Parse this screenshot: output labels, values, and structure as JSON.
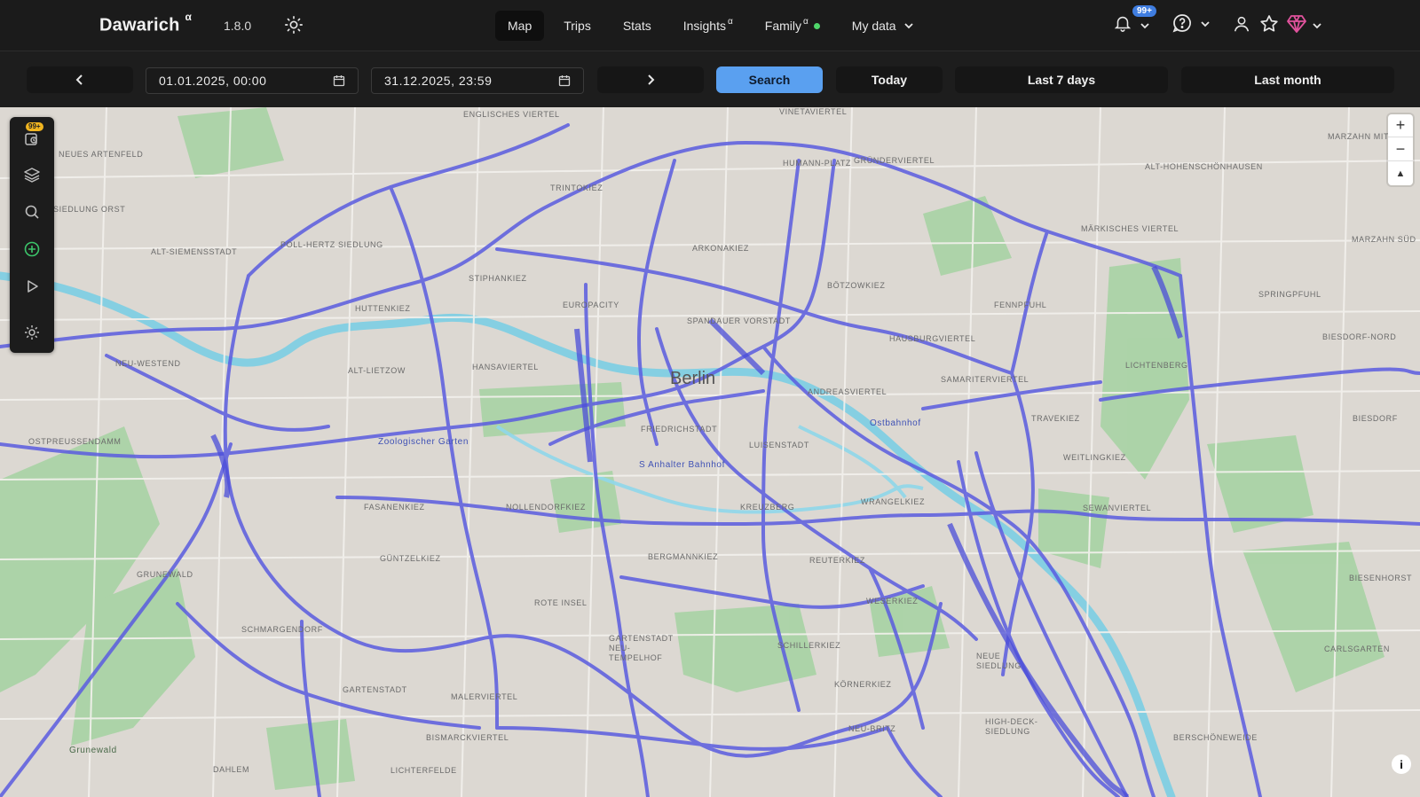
{
  "header": {
    "brand": "Dawarich",
    "brand_sup": "α",
    "version": "1.8.0",
    "nav": [
      {
        "label": "Map",
        "active": true
      },
      {
        "label": "Trips"
      },
      {
        "label": "Stats"
      },
      {
        "label": "Insights",
        "sup": "α"
      },
      {
        "label": "Family",
        "sup": "α",
        "status": "online"
      },
      {
        "label": "My data",
        "dropdown": true
      }
    ],
    "notifications_badge": "99+",
    "icons": [
      "sun-icon",
      "bell-icon",
      "help-icon",
      "user-icon",
      "star-icon",
      "gem-icon"
    ]
  },
  "toolbar": {
    "prev_icon": "chevron-left-icon",
    "next_icon": "chevron-right-icon",
    "start_date": "01.01.2025, 00:00",
    "end_date": "31.12.2025, 23:59",
    "search_label": "Search",
    "today_label": "Today",
    "last7_label": "Last 7 days",
    "last_month_label": "Last month"
  },
  "map": {
    "city": "Berlin",
    "route_color": "#5a5ce0",
    "water_color": "#7fcfe3",
    "park_color": "#9dcea0",
    "labels": [
      "ENGLISCHES VIERTEL",
      "VINETAVIERTEL",
      "NEUES ARTENFELD",
      "SIEDLUNG ORST",
      "GRÜNDERVIERTEL",
      "HUMANN-PLATZ",
      "TRINTOKIEZ",
      "ALT-HOHENSCHÖNHAUSEN",
      "MARZAHN MITTE",
      "MÄRKISCHES VIERTEL",
      "MARZAHN SÜD",
      "POLL-HERTZ SIEDLUNG",
      "ALT-SIEMENSSTADT",
      "ARKONAKIEZ",
      "STIPHANKIEZ",
      "HUTTENKIEZ",
      "EUROPACITY",
      "SPANDAUER VORSTADT",
      "BÖTZOWKIEZ",
      "FENNPFUHL",
      "SPRINGPFUHL",
      "HAUSBURGVIERTEL",
      "BIESDORF-NORD",
      "ALT-LIETZOW",
      "HANSAVIERTEL",
      "ANDREASVIERTEL",
      "SAMARITERVIERTEL",
      "LICHTENBERG",
      "NEU-WESTEND",
      "Ostbahnhof",
      "TRAVEKIEZ",
      "BIESDORF",
      "OSTPREUSSENDAMM",
      "Zoologischer Garten",
      "FRIEDRICHSTADT",
      "LUISENSTADT",
      "WEITLINGKIEZ",
      "S Anhalter Bahnhof",
      "FASANENKIEZ",
      "NOLLENDORFKIEZ",
      "WRANGELKIEZ",
      "SEWANVIERTEL",
      "KREUZBERG",
      "GÜNTZELKIEZ",
      "GRUNEWALD",
      "BERGMANNKIEZ",
      "REUTERKIEZ",
      "BIESENHORST",
      "ROTE INSEL",
      "WESERKIEZ",
      "SCHMARGENDORF",
      "GARTENSTADT NEU-TEMPELHOF",
      "SCHILLERKIEZ",
      "NEUE SIEDLUNG",
      "CARLSGARTEN",
      "GARTENSTADT",
      "KÖRNERKIEZ",
      "MALERVIERTEL",
      "NEU-BRITZ",
      "HIGH-DECK-SIEDLUNG",
      "BERSCHÖNEWEIDE",
      "BISMARCKVIERTEL",
      "DAHLEM",
      "LICHTERFELDE",
      "Grunewald"
    ],
    "zoom_in": "+",
    "zoom_out": "−",
    "compass": "▲",
    "attribution": "i",
    "sidebar_badge": "99+"
  }
}
